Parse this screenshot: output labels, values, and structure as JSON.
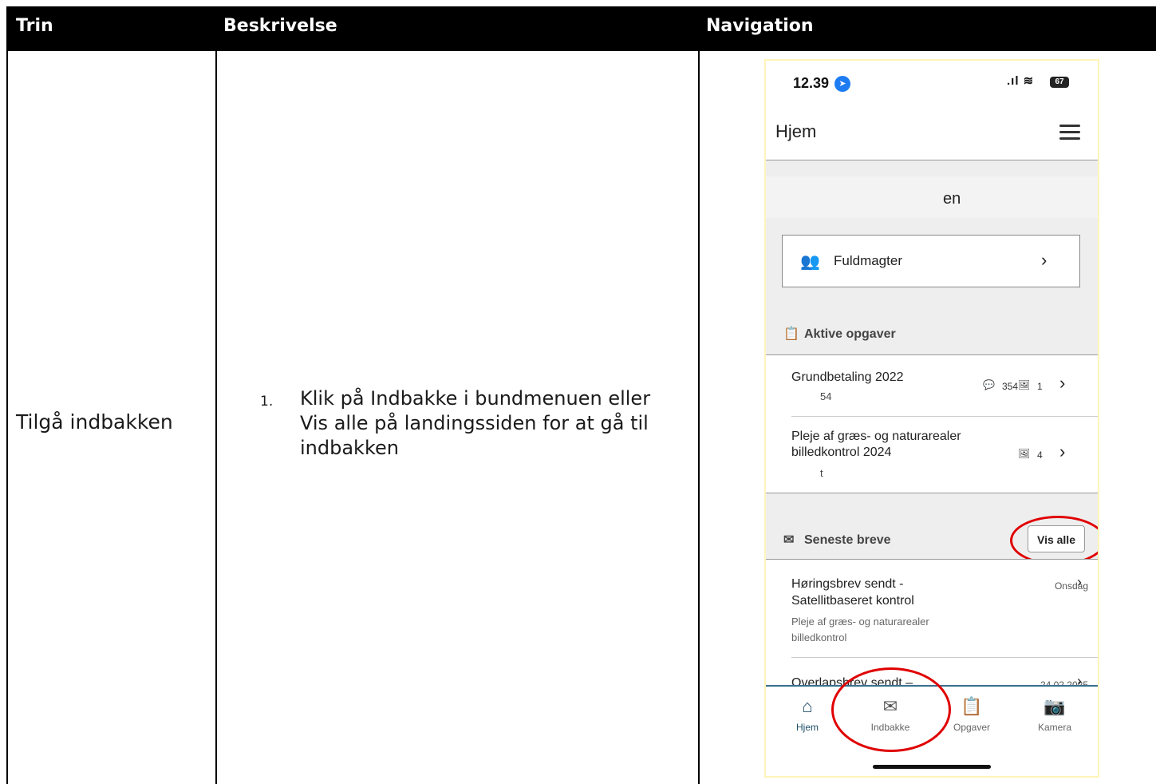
{
  "table": {
    "headers": [
      "Trin",
      "Beskrivelse",
      "Navigation"
    ],
    "step_name": "Tilgå indbakken",
    "step_number": "1.",
    "step_text": "Klik på Indbakke i bundmenuen eller Vis alle på landingssiden for at gå til indbakken"
  },
  "phone": {
    "time": "12.39",
    "battery": "67",
    "title": "Hjem",
    "greeting_fragment": "en",
    "fuldmagter_label": "Fuldmagter",
    "tasks_header": "Aktive opgaver",
    "tasks": [
      {
        "title": "Grundbetaling 2022",
        "sub": "54",
        "comments": "354",
        "images": "1"
      },
      {
        "title_line1": "Pleje af græs- og naturarealer",
        "title_line2": "billedkontrol 2024",
        "sub": "t",
        "images": "4"
      }
    ],
    "letters_header": "Seneste breve",
    "vis_alle": "Vis alle",
    "letters": [
      {
        "title_line1": "Høringsbrev sendt -",
        "title_line2": "Satellitbaseret kontrol",
        "sub_line1": "Pleje af græs- og naturarealer",
        "sub_line2": "billedkontrol",
        "date": "Onsdag"
      },
      {
        "title_line1": "Overlapsbrev sendt –",
        "date": "24.02.2025"
      }
    ],
    "nav": [
      {
        "label": "Hjem",
        "icon": "home-icon"
      },
      {
        "label": "Indbakke",
        "icon": "mail-icon"
      },
      {
        "label": "Opgaver",
        "icon": "clipboard-icon"
      },
      {
        "label": "Kamera",
        "icon": "camera-icon"
      }
    ],
    "colors": {
      "highlight_ring": "#e00000",
      "nav_active": "#1f4e6b",
      "status_location": "#1e7cf2"
    }
  }
}
